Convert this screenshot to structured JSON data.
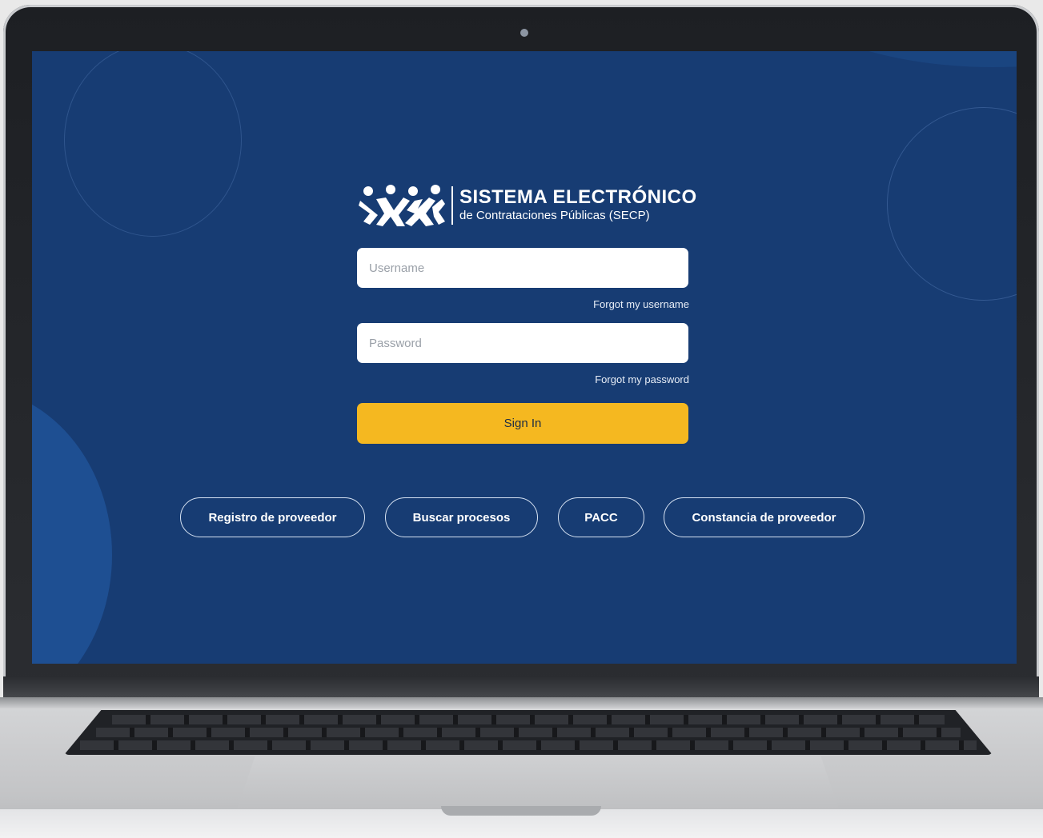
{
  "brand": {
    "title": "SISTEMA ELECTRÓNICO",
    "subtitle": "de Contrataciones Públicas (SECP)",
    "logo_icon": "people-chain-logo"
  },
  "login": {
    "username_placeholder": "Username",
    "username_value": "",
    "forgot_username": "Forgot my username",
    "password_placeholder": "Password",
    "password_value": "",
    "forgot_password": "Forgot my password",
    "signin_label": "Sign In"
  },
  "links": [
    {
      "label": "Registro de proveedor"
    },
    {
      "label": "Buscar procesos"
    },
    {
      "label": "PACC"
    },
    {
      "label": "Constancia de proveedor"
    }
  ],
  "colors": {
    "background": "#173c73",
    "accent": "#f5b820",
    "text": "#ffffff"
  }
}
